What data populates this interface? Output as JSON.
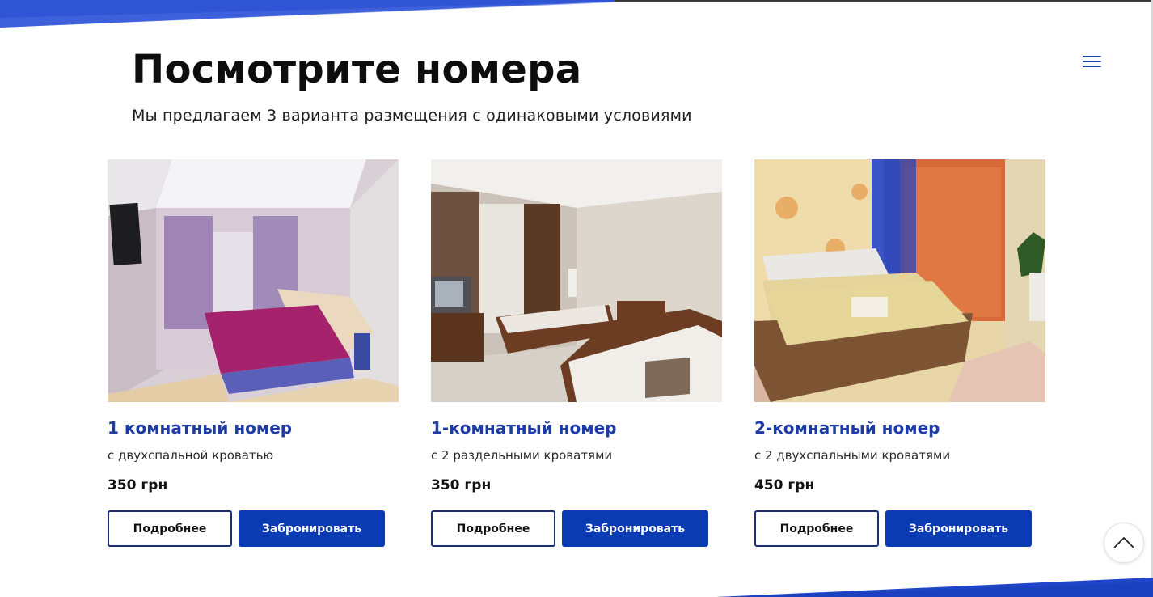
{
  "header": {
    "title": "Посмотрите номера",
    "subtitle": "Мы предлагаем 3 варианта размещения с одинаковыми условиями"
  },
  "menu": {
    "icon": "hamburger-menu-icon"
  },
  "colors": {
    "accent": "#0a3bb3",
    "title_blue": "#1d3aa6",
    "deco_blue": "#2f55d4"
  },
  "rooms": [
    {
      "title": "1 комнатный номер",
      "description": "с двухспальной кроватью",
      "price": "350 грн",
      "more_label": "Подробнее",
      "book_label": "Забронировать"
    },
    {
      "title": "1-комнатный номер",
      "description": "с 2 раздельными кроватями",
      "price": "350 грн",
      "more_label": "Подробнее",
      "book_label": "Забронировать"
    },
    {
      "title": "2-комнатный номер",
      "description": "с 2 двухспальными кроватями",
      "price": "450 грн",
      "more_label": "Подробнее",
      "book_label": "Забронировать"
    }
  ],
  "scroll_top": {
    "icon": "chevron-up-icon"
  }
}
